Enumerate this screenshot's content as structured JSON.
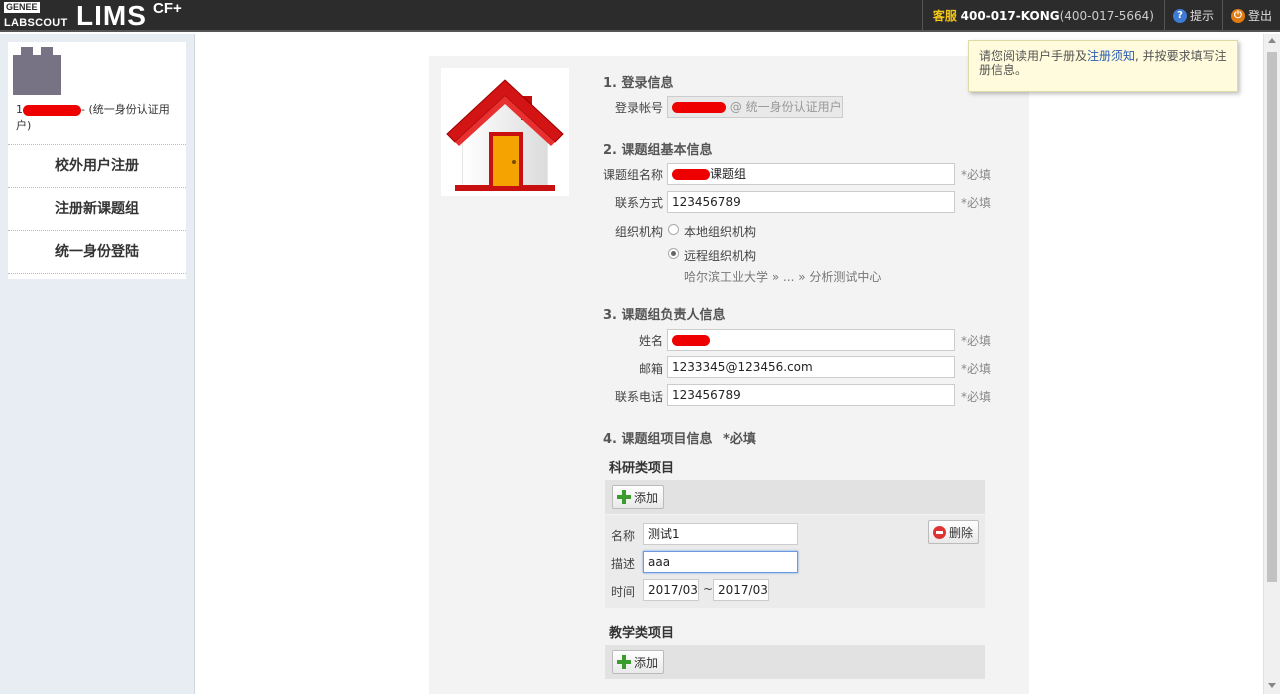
{
  "header": {
    "logo_genee": "GENEE",
    "logo_labscout": "LABSCOUT",
    "logo_lims": "LIMS",
    "logo_cf": "CF+",
    "hotline_label": "客服",
    "hotline_number": "400-017-KONG",
    "hotline_alt": "(400-017-5664)",
    "help_label": "提示",
    "logout_label": "登出",
    "help_icon": "?",
    "power_icon": "⏻"
  },
  "sidebar": {
    "user_suffix": "- (统一身份认证用户)",
    "user_prefix": "1",
    "items": [
      {
        "label": "校外用户注册"
      },
      {
        "label": "注册新课题组"
      },
      {
        "label": "统一身份登陆"
      }
    ]
  },
  "tooltip": {
    "text_before": "请您阅读用户手册及",
    "link": "注册须知",
    "text_after": ", 并按要求填写注册信息。"
  },
  "form": {
    "s1_title": "1. 登录信息",
    "account_label": "登录帐号",
    "account_suffix": "@ 统一身份认证用户",
    "s2_title": "2. 课题组基本信息",
    "group_name_label": "课题组名称",
    "group_name_value": "课题组",
    "contact_label": "联系方式",
    "contact_value": "123456789",
    "org_label": "组织机构",
    "org_local": "本地组织机构",
    "org_remote": "远程组织机构",
    "org_path": "哈尔滨工业大学 » ... » 分析测试中心",
    "required": "*必填",
    "s3_title": "3. 课题组负责人信息",
    "name_label": "姓名",
    "email_label": "邮箱",
    "email_value": "1233345@123456.com",
    "phone_label": "联系电话",
    "phone_value": "123456789",
    "s4_title": "4. 课题组项目信息",
    "s4_required": "*必填",
    "research_title": "科研类项目",
    "add_label": "添加",
    "delete_label": "删除",
    "proj_name_label": "名称",
    "proj_name_value": "测试1",
    "proj_desc_label": "描述",
    "proj_desc_value": "aaa",
    "proj_time_label": "时间",
    "proj_time_start": "2017/03",
    "proj_time_sep": "~",
    "proj_time_end": "2017/03",
    "teaching_title": "教学类项目"
  },
  "colors": {
    "topbar": "#2c2c2c",
    "hotline_label": "#f5c518",
    "sidebar_bg": "#e8edf3",
    "form_bg": "#f3f3f3",
    "tooltip_bg": "#fffbdc",
    "add_icon": "#3a9c2c",
    "delete_icon": "#dd3333",
    "redaction": "#ee0000"
  },
  "icons": {
    "house": "house-icon",
    "help": "help-icon",
    "power": "power-icon",
    "add": "plus-icon",
    "delete": "minus-circle-icon"
  }
}
